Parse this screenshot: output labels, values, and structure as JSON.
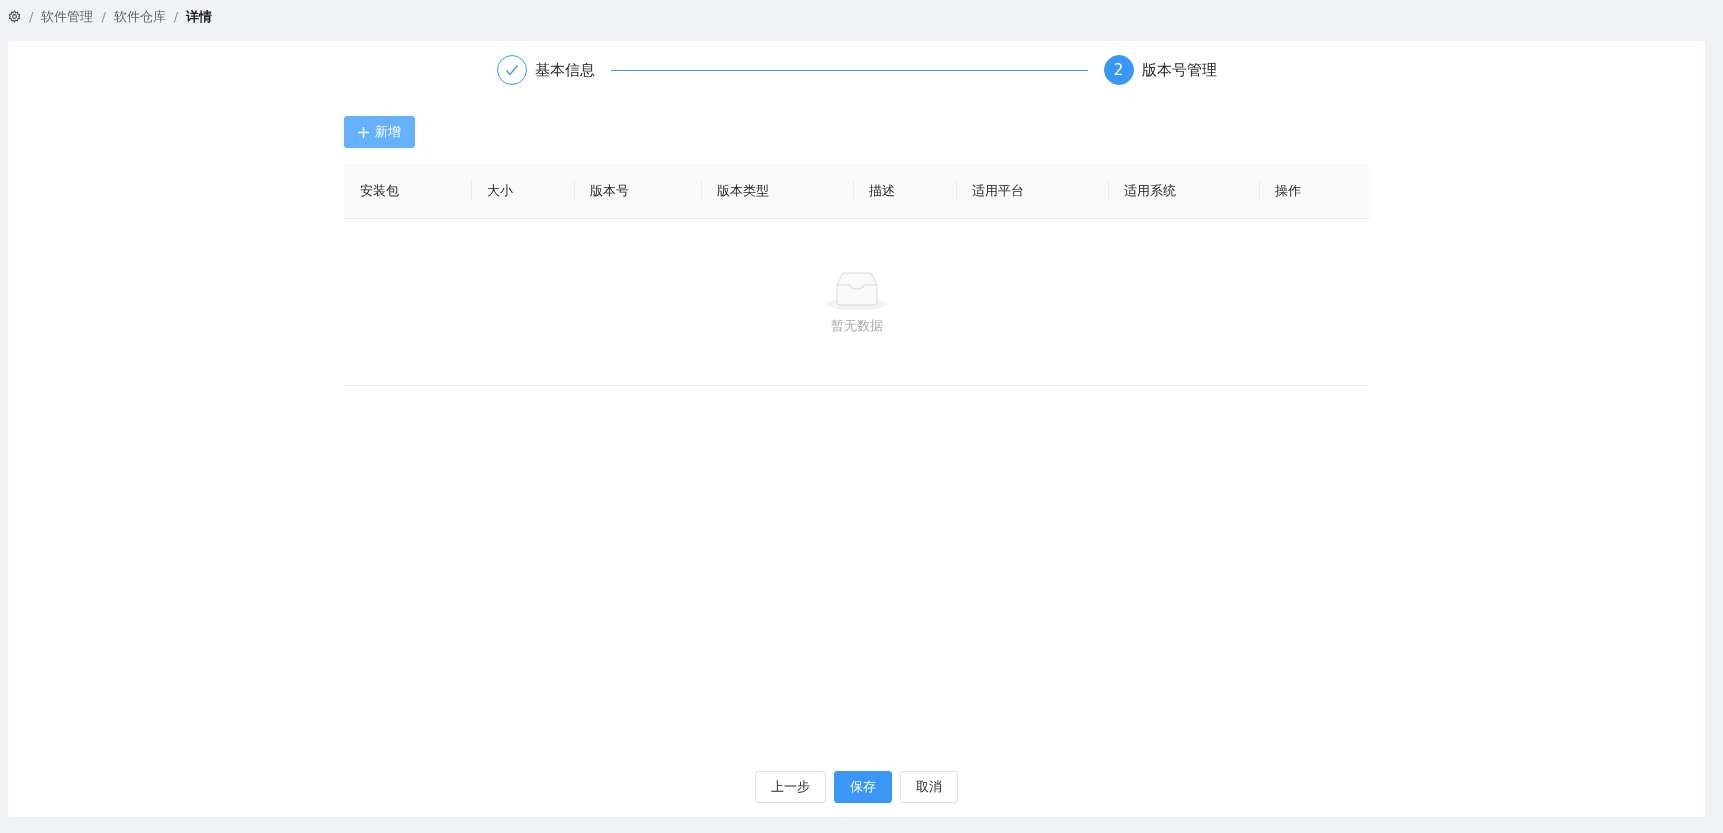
{
  "breadcrumb": {
    "separator": "/",
    "items": [
      {
        "label": "软件管理",
        "current": false
      },
      {
        "label": "软件仓库",
        "current": false
      },
      {
        "label": "详情",
        "current": true
      }
    ]
  },
  "steps": [
    {
      "label": "基本信息",
      "done": true
    },
    {
      "label": "版本号管理",
      "done": false,
      "number": "2"
    }
  ],
  "add_button": "新增",
  "table": {
    "columns": [
      "安装包",
      "大小",
      "版本号",
      "版本类型",
      "描述",
      "适用平台",
      "适用系统",
      "操作"
    ],
    "empty_text": "暂无数据"
  },
  "footer_buttons": [
    {
      "label": "上一步",
      "kind": "default"
    },
    {
      "label": "保存",
      "kind": "primary"
    },
    {
      "label": "取消",
      "kind": "default"
    }
  ]
}
